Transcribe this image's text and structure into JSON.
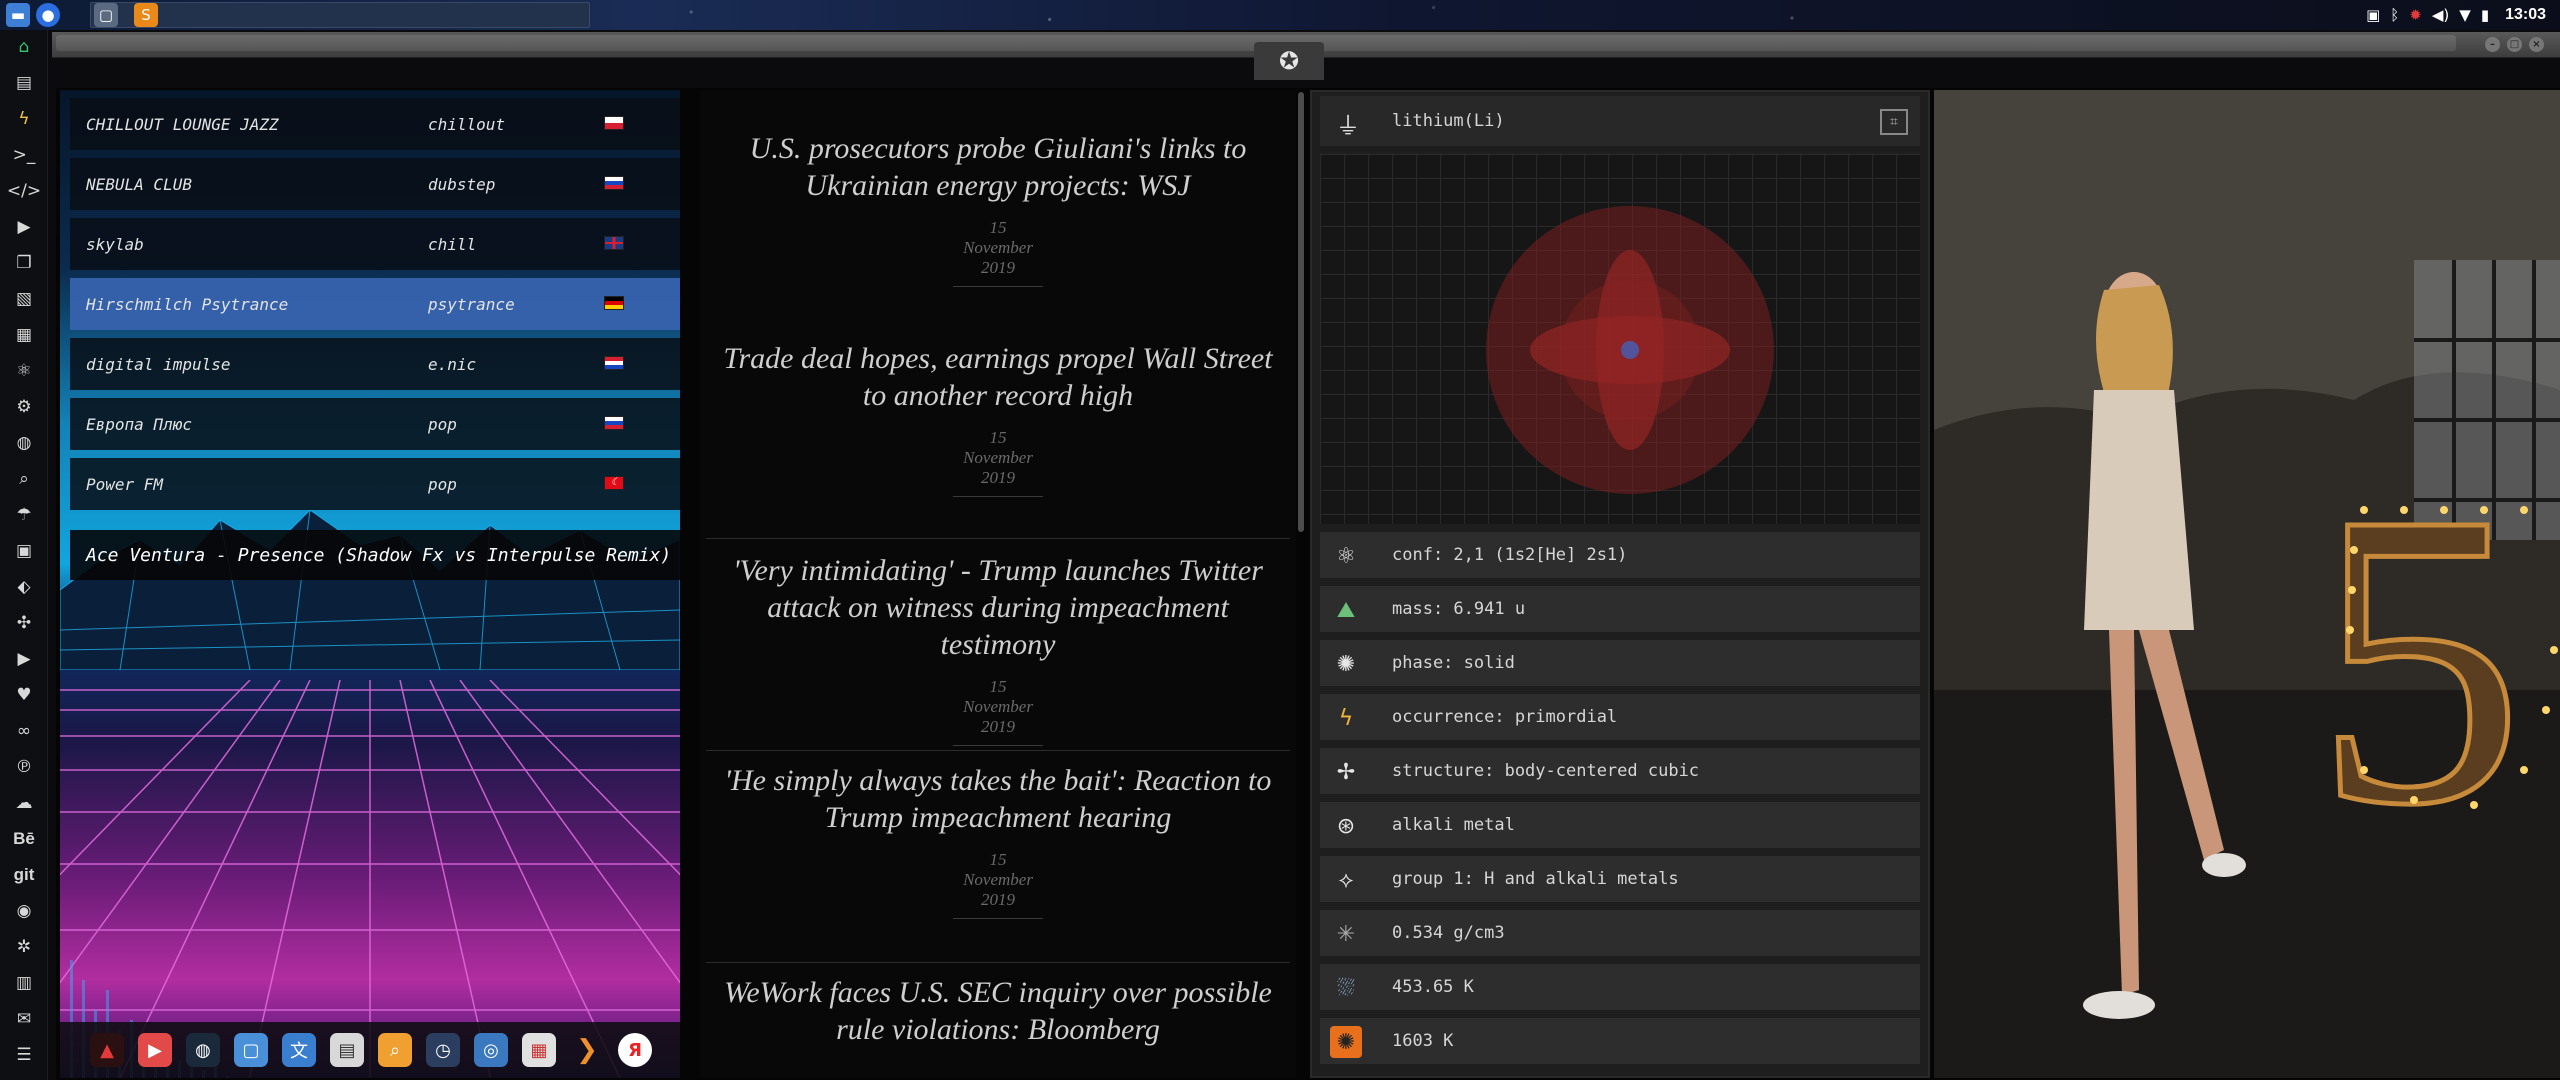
{
  "topbar": {
    "clock": "13:03",
    "apps": [
      "files-app",
      "browser-app",
      "window-app",
      "sublime-app"
    ],
    "tray_icons": [
      "screenshot-icon",
      "bluetooth-icon",
      "settings-gear-icon",
      "volume-icon",
      "wifi-icon",
      "battery-icon"
    ]
  },
  "dock": {
    "items": [
      "home-icon",
      "document-icon",
      "flash-icon",
      "terminal-icon",
      "code-icon",
      "play-icon",
      "copy-icon",
      "image-icon",
      "news-icon",
      "atom-icon",
      "gear-icon",
      "globe-icon",
      "search-icon",
      "umbrella-icon",
      "contact-icon",
      "tag-icon",
      "tools-icon",
      "youtube-icon",
      "heart-icon",
      "lastfm-icon",
      "pinterest-icon",
      "cloud-icon"
    ],
    "text_items": [
      "Bē",
      "git"
    ],
    "bottom_items": [
      "github-icon",
      "bug-icon",
      "map-icon",
      "mail-icon",
      "list-icon"
    ]
  },
  "window": {
    "controls": [
      "minimize",
      "maximize",
      "close"
    ]
  },
  "radio": {
    "stations": [
      {
        "name": "CHILLOUT LOUNGE JAZZ",
        "genre": "chillout",
        "flag": "pl"
      },
      {
        "name": "NEBULA CLUB",
        "genre": "dubstep",
        "flag": "ru"
      },
      {
        "name": "skylab",
        "genre": "chill",
        "flag": "gb"
      },
      {
        "name": "Hirschmilch Psytrance",
        "genre": "psytrance",
        "flag": "de"
      },
      {
        "name": "digital impulse",
        "genre": "e.nic",
        "flag": "hr"
      },
      {
        "name": "Европа Плюс",
        "genre": "pop",
        "flag": "ru"
      },
      {
        "name": "Power FM",
        "genre": "pop",
        "flag": "tr"
      }
    ],
    "active_index": 3,
    "now_playing": "Ace Ventura - Presence (Shadow Fx vs Interpulse Remix)",
    "launcher_icons": [
      "scrobbler-icon",
      "youtube-icon",
      "globe-dark-icon",
      "window-icon",
      "translate-icon",
      "calendar-news-icon",
      "search-icon",
      "clock-icon",
      "web-icon",
      "calendar-icon",
      "arrow-icon",
      "yandex-icon"
    ]
  },
  "news": {
    "items": [
      {
        "title": "U.S. prosecutors probe Giuliani's links to Ukrainian energy projects: WSJ",
        "date": "15 November 2019"
      },
      {
        "title": "Trade deal hopes, earnings propel Wall Street to another record high",
        "date": "15 November 2019"
      },
      {
        "title": "'Very intimidating' - Trump launches Twitter attack on witness during impeachment testimony",
        "date": "15 November 2019"
      },
      {
        "title": "'He simply always takes the bait': Reaction to Trump impeachment hearing",
        "date": "15 November 2019"
      },
      {
        "title": "WeWork faces U.S. SEC inquiry over possible rule violations: Bloomberg",
        "date": ""
      }
    ]
  },
  "element": {
    "title": "lithium(Li)",
    "props": [
      {
        "icon": "atom-icon",
        "text": "conf: 2,1 (1s2[He] 2s1)"
      },
      {
        "icon": "scale-icon",
        "text": "mass: 6.941 u"
      },
      {
        "icon": "orbit-icon",
        "text": "phase: solid"
      },
      {
        "icon": "lightning-icon",
        "text": "occurrence: primordial"
      },
      {
        "icon": "molecule-icon",
        "text": "structure: body-centered cubic"
      },
      {
        "icon": "alkali-icon",
        "text": "alkali metal"
      },
      {
        "icon": "group-icon",
        "text": "group 1: H and alkali metals"
      },
      {
        "icon": "density-icon",
        "text": "0.534 g/cm3"
      },
      {
        "icon": "melting-icon",
        "text": "453.65 K"
      },
      {
        "icon": "boiling-icon",
        "text": "1603 K"
      }
    ]
  },
  "colors": {
    "accent_selected": "#3764af",
    "radio_highlight": "#11a5de",
    "news_title": "#cfcfcf",
    "panel_bg": "#2d2d2d"
  }
}
